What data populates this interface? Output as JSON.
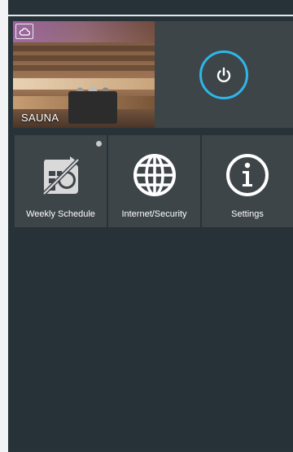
{
  "hero": {
    "label": "SAUNA",
    "cloud_icon": "cloud-icon",
    "power_icon": "power-icon",
    "accent_color": "#2fb6e8"
  },
  "tiles": [
    {
      "label": "Weekly Schedule",
      "icon": "schedule-disabled-icon",
      "has_indicator": true
    },
    {
      "label": "Internet/Security",
      "icon": "globe-icon"
    },
    {
      "label": "Settings",
      "icon": "info-icon"
    }
  ]
}
